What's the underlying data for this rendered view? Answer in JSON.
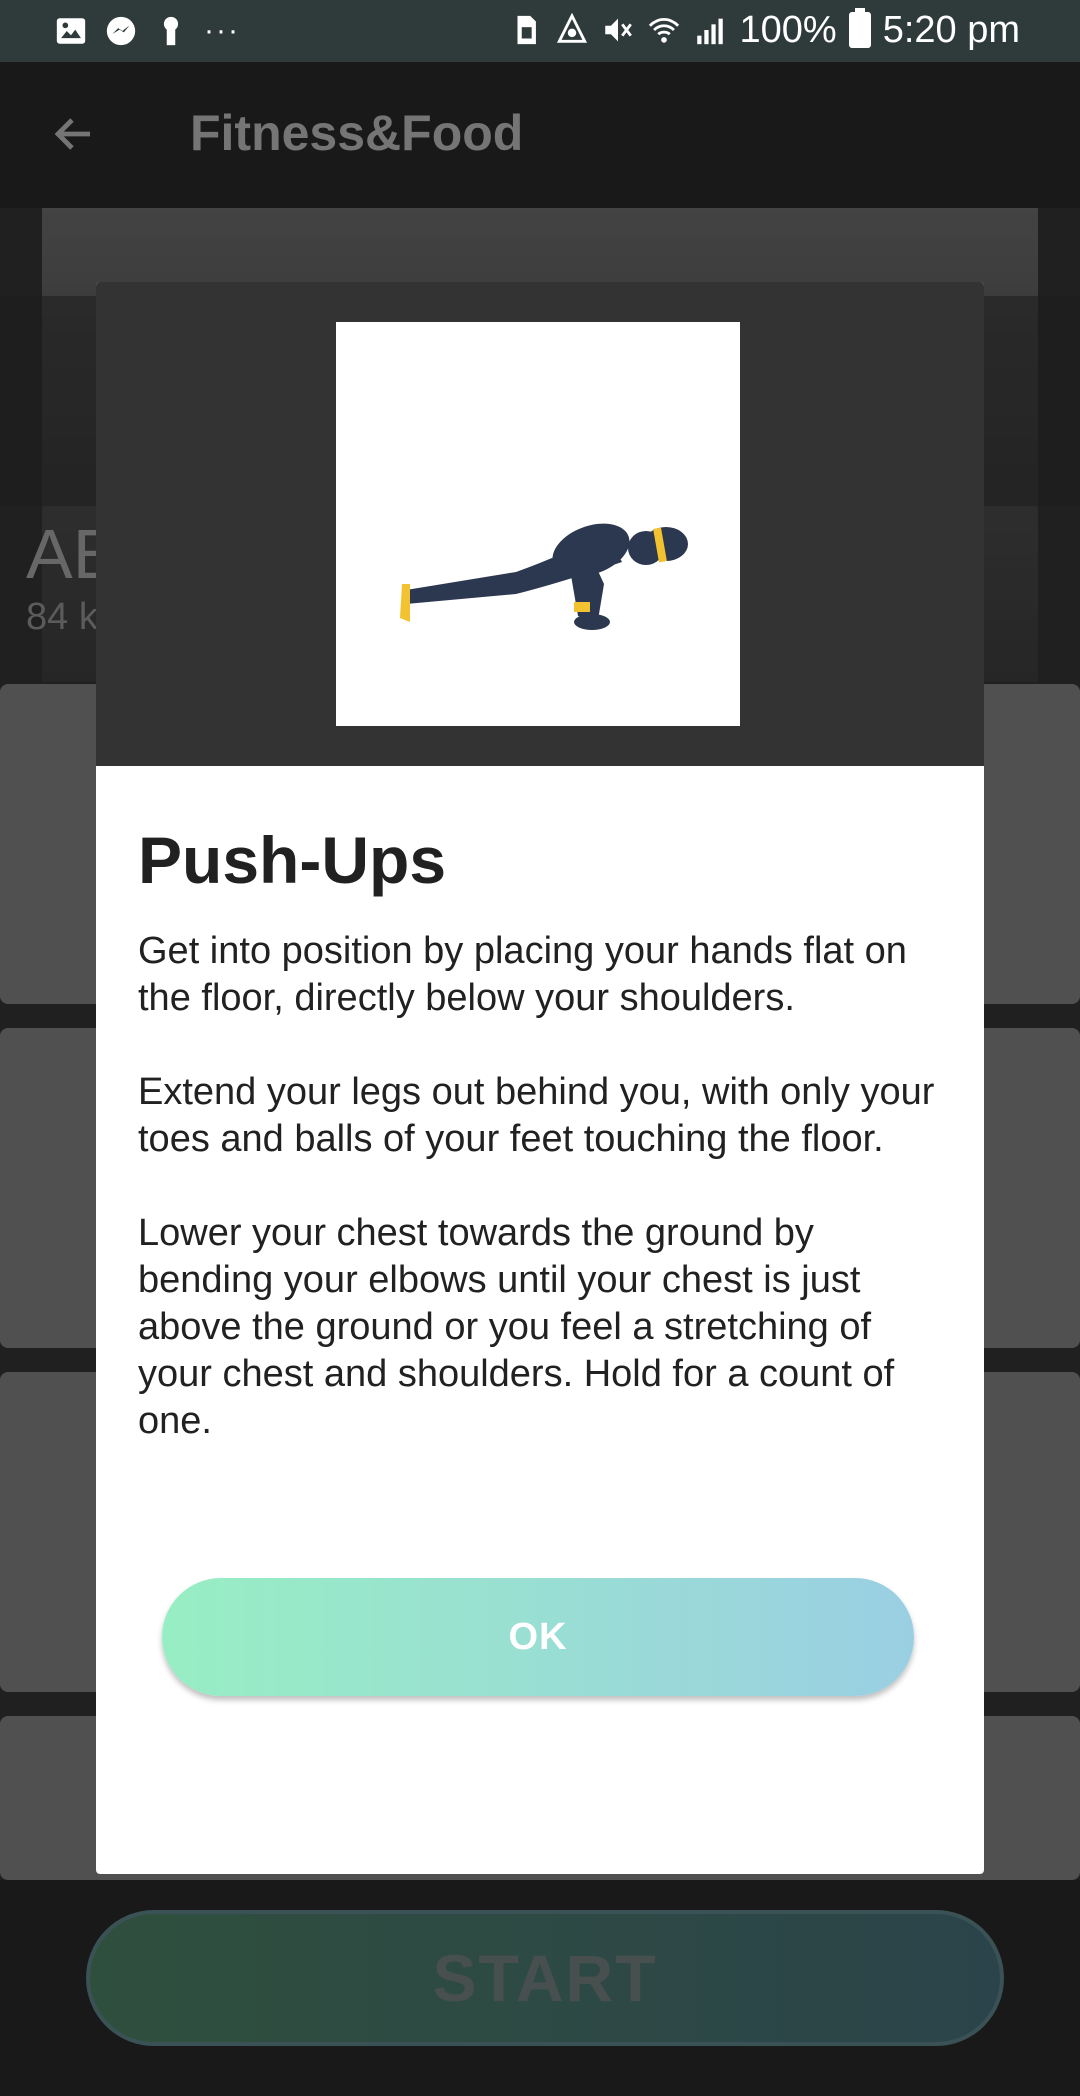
{
  "status_bar": {
    "battery": "100%",
    "time": "5:20 pm",
    "overflow": "···"
  },
  "app_bar": {
    "title": "Fitness&Food"
  },
  "background": {
    "workout_title_partial": "AE",
    "workout_sub_partial": "84 k",
    "start_label": "START"
  },
  "dialog": {
    "title": "Push-Ups",
    "paragraphs": [
      "Get into position by placing your hands flat on the floor, directly below your shoulders.",
      "Extend your legs out behind you, with only your toes and balls of your feet touching the floor.",
      "Lower your chest towards the ground by bending your elbows until your chest is just above the ground or you feel a stretching of your chest and shoulders. Hold for a count of one."
    ],
    "ok_label": "OK"
  },
  "colors": {
    "accent_start": "#98eec3",
    "accent_end": "#9acfe3",
    "status_bar": "#2f3b3a"
  }
}
